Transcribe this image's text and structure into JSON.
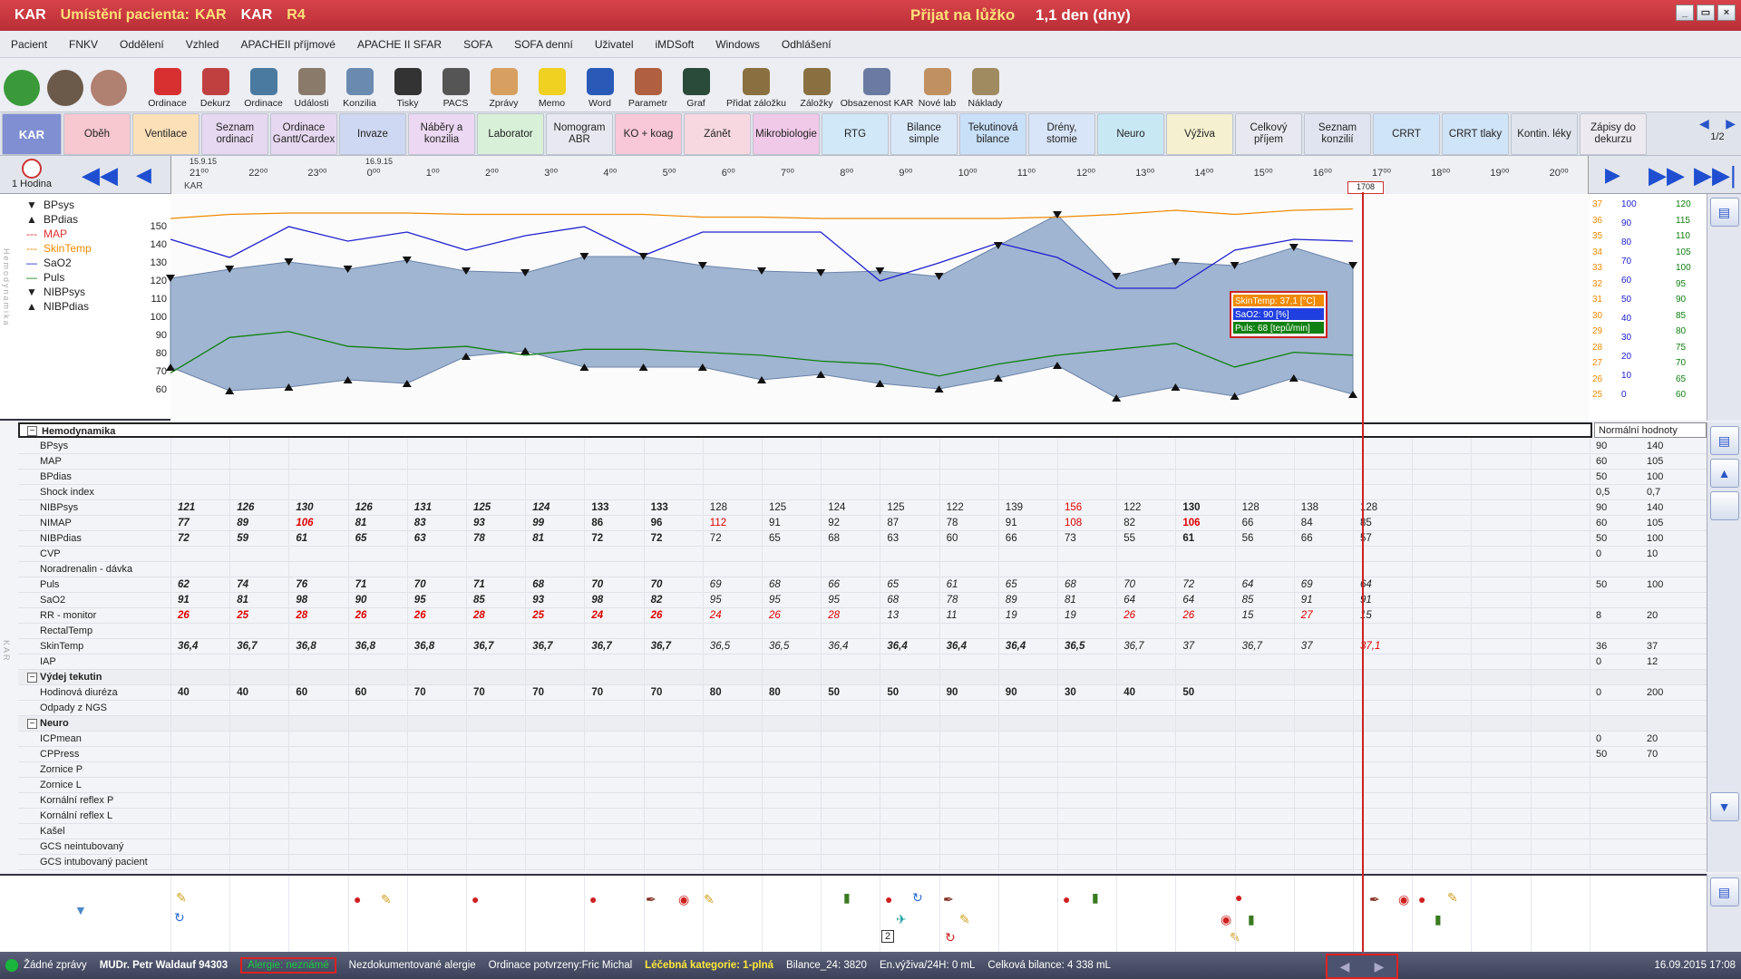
{
  "title": {
    "app": "KAR",
    "location_label": "Umístění pacienta:",
    "location": "KAR",
    "ward": "KAR",
    "room": "R4",
    "admit_label": "Přijat na lůžko",
    "admit_value": "1,1 den (dny)"
  },
  "window_buttons": [
    "_",
    "▭",
    "×"
  ],
  "menu": [
    "Pacient",
    "FNKV",
    "Oddělení",
    "Vzhled",
    "APACHEII příjmové",
    "APACHE II SFAR",
    "SOFA",
    "SOFA denní",
    "Uživatel",
    "iMDSoft",
    "Windows",
    "Odhlášení"
  ],
  "toolbar": [
    {
      "label": "",
      "icon": "refresh-icon",
      "color": "#3a9a3a",
      "big": true
    },
    {
      "label": "",
      "icon": "doctor-avatar-icon",
      "color": "#6b5a4a",
      "big": true
    },
    {
      "label": "",
      "icon": "nurse-avatar-icon",
      "color": "#b08070",
      "big": true
    },
    {
      "label": "Ordinace",
      "icon": "alarm-clock-icon",
      "color": "#d83030"
    },
    {
      "label": "Dekurz",
      "icon": "books-icon",
      "color": "#c04040"
    },
    {
      "label": "Ordinace",
      "icon": "server-icon",
      "color": "#4a7aa0"
    },
    {
      "label": "Události",
      "icon": "person-writing-icon",
      "color": "#8a7a6a"
    },
    {
      "label": "Konzilia",
      "icon": "doctor-icon",
      "color": "#6a8ab0"
    },
    {
      "label": "Tisky",
      "icon": "printer-icon",
      "color": "#333333"
    },
    {
      "label": "PACS",
      "icon": "xray-icon",
      "color": "#555555"
    },
    {
      "label": "Zprávy",
      "icon": "envelope-icon",
      "color": "#d8a060"
    },
    {
      "label": "Memo",
      "icon": "sticky-note-icon",
      "color": "#f0d020"
    },
    {
      "label": "Word",
      "icon": "word-icon",
      "color": "#2a5ab8"
    },
    {
      "label": "Parametr",
      "icon": "technician-icon",
      "color": "#b06040"
    },
    {
      "label": "Graf",
      "icon": "monitor-graph-icon",
      "color": "#2a4a3a"
    },
    {
      "label": "Přidat záložku",
      "icon": "bookmark-add-icon",
      "color": "#8a7040",
      "wide": true
    },
    {
      "label": "Záložky",
      "icon": "bookmarks-icon",
      "color": "#8a7040"
    },
    {
      "label": "Obsazenost KAR",
      "icon": "bed-occupancy-icon",
      "color": "#6a7aa0",
      "wide": true
    },
    {
      "label": "Nové lab",
      "icon": "lab-flask-icon",
      "color": "#c09060"
    },
    {
      "label": "Náklady",
      "icon": "money-bag-icon",
      "color": "#a08a60"
    }
  ],
  "tabs": [
    {
      "label": "KAR",
      "color": "#7f8fd2"
    },
    {
      "label": "Oběh",
      "color": "#f7c8d0"
    },
    {
      "label": "Ventilace",
      "color": "#fbe0b8"
    },
    {
      "label": "Seznam ordinací",
      "color": "#e6d8f0"
    },
    {
      "label": "Ordinace Gantt/Cardex",
      "color": "#e6d8f0"
    },
    {
      "label": "Invaze",
      "color": "#cfd8f2"
    },
    {
      "label": "Náběry a konzilia",
      "color": "#ecd8f2"
    },
    {
      "label": "Laborator",
      "color": "#d8f0d8"
    },
    {
      "label": "Nomogram ABR",
      "color": "#e8e8f0"
    },
    {
      "label": "KO + koag",
      "color": "#f8c8d8"
    },
    {
      "label": "Zánět",
      "color": "#f8d8e0"
    },
    {
      "label": "Mikrobiologie",
      "color": "#f0c8e8"
    },
    {
      "label": "RTG",
      "color": "#d0e8f8"
    },
    {
      "label": "Bilance simple",
      "color": "#d8e8f8"
    },
    {
      "label": "Tekutinová bilance",
      "color": "#c8e0f8"
    },
    {
      "label": "Drény, stomie",
      "color": "#d8e4f8"
    },
    {
      "label": "Neuro",
      "color": "#c8e8f4"
    },
    {
      "label": "Výživa",
      "color": "#f4f0d0"
    },
    {
      "label": "Celkový příjem",
      "color": "#e8e8f0"
    },
    {
      "label": "Seznam konzilií",
      "color": "#e0e4f0"
    },
    {
      "label": "CRRT",
      "color": "#d0e4f8"
    },
    {
      "label": "CRRT tlaky",
      "color": "#d0e4f8"
    },
    {
      "label": "Kontin. léky",
      "color": "#e0e4ec"
    },
    {
      "label": "Zápisy do dekurzu",
      "color": "#eceaf0"
    }
  ],
  "tab_page": "1/2",
  "timebar": {
    "interval": "1 Hodina",
    "date1": "15.9.15",
    "date2": "16.9.15",
    "ward": "KAR",
    "marker": "1708",
    "ticks": [
      "21⁰⁰",
      "22⁰⁰",
      "23⁰⁰",
      "0⁰⁰",
      "1⁰⁰",
      "2⁰⁰",
      "3⁰⁰",
      "4⁰⁰",
      "5⁰⁰",
      "6⁰⁰",
      "7⁰⁰",
      "8⁰⁰",
      "9⁰⁰",
      "10⁰⁰",
      "11⁰⁰",
      "12⁰⁰",
      "13⁰⁰",
      "14⁰⁰",
      "15⁰⁰",
      "16⁰⁰",
      "17⁰⁰",
      "18⁰⁰",
      "19⁰⁰",
      "20⁰⁰"
    ]
  },
  "legend": [
    {
      "label": "BPsys",
      "color": "#222222",
      "sym": "▼"
    },
    {
      "label": "BPdias",
      "color": "#222222",
      "sym": "▲"
    },
    {
      "label": "MAP",
      "color": "#e03030",
      "sym": "---"
    },
    {
      "label": "SkinTemp",
      "color": "#f08a00",
      "sym": "---"
    },
    {
      "label": "SaO2",
      "color": "#2020d0",
      "sym": "—"
    },
    {
      "label": "Puls",
      "color": "#108010",
      "sym": "—"
    },
    {
      "label": "NIBPsys",
      "color": "#222222",
      "sym": "▼"
    },
    {
      "label": "NIBPdias",
      "color": "#222222",
      "sym": "▲"
    }
  ],
  "side_label_chart": "Hemodynamika",
  "side_label_grid": "KAR",
  "yaxis": [
    "150",
    "140",
    "130",
    "120",
    "110",
    "100",
    "90",
    "80",
    "70",
    "60"
  ],
  "right_scales": {
    "temp": [
      "37",
      "36",
      "35",
      "34",
      "33",
      "32",
      "31",
      "30",
      "29",
      "28",
      "27",
      "26",
      "25"
    ],
    "sao2": [
      "100",
      "90",
      "80",
      "70",
      "60",
      "50",
      "40",
      "30",
      "20",
      "10",
      "0"
    ],
    "puls": [
      "120",
      "115",
      "110",
      "105",
      "100",
      "95",
      "90",
      "85",
      "80",
      "75",
      "70",
      "65",
      "60"
    ]
  },
  "colors": {
    "temp": "#f08a00",
    "sao2": "#2020d0",
    "puls": "#108010"
  },
  "tooltip": {
    "l1": "SkinTemp: 37,1 [°C]",
    "l2": "SaO2: 90 [%]",
    "l3": "Puls: 68 [tepů/min]"
  },
  "chart_data": {
    "type": "line",
    "x": [
      "21:00",
      "22:00",
      "23:00",
      "0:00",
      "1:00",
      "2:00",
      "3:00",
      "4:00",
      "5:00",
      "6:00",
      "7:00",
      "8:00",
      "9:00",
      "10:00",
      "11:00",
      "12:00",
      "13:00",
      "14:00",
      "15:00",
      "16:00",
      "17:00"
    ],
    "ylim": [
      55,
      155
    ],
    "series": [
      {
        "name": "NIBPsys",
        "values": [
          121,
          126,
          130,
          126,
          131,
          125,
          124,
          133,
          133,
          128,
          125,
          124,
          125,
          122,
          139,
          156,
          122,
          130,
          128,
          138,
          128
        ]
      },
      {
        "name": "NIBPdias",
        "values": [
          72,
          59,
          61,
          65,
          63,
          78,
          81,
          72,
          72,
          72,
          65,
          68,
          63,
          60,
          66,
          73,
          55,
          61,
          56,
          66,
          57
        ]
      },
      {
        "name": "SaO2",
        "values": [
          91,
          81,
          98,
          90,
          95,
          85,
          93,
          98,
          82,
          95,
          95,
          95,
          68,
          78,
          89,
          81,
          64,
          64,
          85,
          91,
          90
        ]
      },
      {
        "name": "Puls",
        "values": [
          62,
          74,
          76,
          71,
          70,
          71,
          68,
          70,
          70,
          69,
          68,
          66,
          65,
          61,
          65,
          68,
          70,
          72,
          64,
          69,
          68
        ]
      },
      {
        "name": "SkinTemp",
        "values": [
          36.4,
          36.7,
          36.8,
          36.8,
          36.8,
          36.7,
          36.7,
          36.7,
          36.7,
          36.5,
          36.5,
          36.4,
          36.4,
          36.4,
          36.4,
          36.5,
          36.7,
          37,
          36.7,
          37,
          37.1
        ]
      }
    ]
  },
  "grid": {
    "header": "Hemodynamika",
    "norm_header": "Normální hodnoty",
    "rows": [
      {
        "label": "BPsys",
        "norm": [
          "90",
          "140"
        ]
      },
      {
        "label": "MAP",
        "norm": [
          "60",
          "105"
        ]
      },
      {
        "label": "BPdias",
        "norm": [
          "50",
          "100"
        ]
      },
      {
        "label": "Shock index",
        "norm": [
          "0,5",
          "0,7"
        ]
      },
      {
        "label": "NIBPsys",
        "norm": [
          "90",
          "140"
        ],
        "values": [
          "121",
          "126",
          "130",
          "126",
          "131",
          "125",
          "124",
          "133",
          "133",
          "128",
          "125",
          "124",
          "125",
          "122",
          "139",
          "156",
          "122",
          "130",
          "128",
          "138",
          "128"
        ],
        "styles": [
          "bi",
          "bi",
          "bi",
          "bi",
          "bi",
          "bi",
          "bi",
          "b",
          "b",
          "",
          "",
          "",
          "",
          "",
          "",
          "red",
          "",
          "b",
          "",
          "",
          ""
        ]
      },
      {
        "label": "NIMAP",
        "norm": [
          "60",
          "105"
        ],
        "values": [
          "77",
          "89",
          "106",
          "81",
          "83",
          "93",
          "99",
          "86",
          "96",
          "112",
          "91",
          "92",
          "87",
          "78",
          "91",
          "108",
          "82",
          "106",
          "66",
          "84",
          "85"
        ],
        "styles": [
          "bi",
          "bi",
          "bi red",
          "bi",
          "bi",
          "bi",
          "bi",
          "b",
          "b",
          "red",
          "",
          "",
          "",
          "",
          "",
          "red",
          "",
          "b red",
          "",
          "",
          ""
        ]
      },
      {
        "label": "NIBPdias",
        "norm": [
          "50",
          "100"
        ],
        "values": [
          "72",
          "59",
          "61",
          "65",
          "63",
          "78",
          "81",
          "72",
          "72",
          "72",
          "65",
          "68",
          "63",
          "60",
          "66",
          "73",
          "55",
          "61",
          "56",
          "66",
          "57"
        ],
        "styles": [
          "bi",
          "bi",
          "bi",
          "bi",
          "bi",
          "bi",
          "bi",
          "b",
          "b",
          "",
          "",
          "",
          "",
          "",
          "",
          "",
          "",
          "b",
          "",
          "",
          ""
        ]
      },
      {
        "label": "CVP",
        "norm": [
          "0",
          "10"
        ]
      },
      {
        "label": "Noradrenalin - dávka",
        "norm": [
          "",
          ""
        ]
      },
      {
        "label": "Puls",
        "norm": [
          "50",
          "100"
        ],
        "values": [
          "62",
          "74",
          "76",
          "71",
          "70",
          "71",
          "68",
          "70",
          "70",
          "69",
          "68",
          "66",
          "65",
          "61",
          "65",
          "68",
          "70",
          "72",
          "64",
          "69",
          "64"
        ],
        "styles": [
          "bi",
          "bi",
          "bi",
          "bi",
          "bi",
          "bi",
          "bi",
          "bi",
          "bi",
          "i",
          "i",
          "i",
          "i",
          "i",
          "i",
          "i",
          "i",
          "i",
          "i",
          "i",
          "i"
        ]
      },
      {
        "label": "SaO2",
        "norm": [
          "",
          ""
        ],
        "values": [
          "91",
          "81",
          "98",
          "90",
          "95",
          "85",
          "93",
          "98",
          "82",
          "95",
          "95",
          "95",
          "68",
          "78",
          "89",
          "81",
          "64",
          "64",
          "85",
          "91",
          "91"
        ],
        "styles": [
          "bi",
          "bi",
          "bi",
          "bi",
          "bi",
          "bi",
          "bi",
          "bi",
          "bi",
          "i",
          "i",
          "i",
          "i",
          "i",
          "i",
          "i",
          "i",
          "i",
          "i",
          "i",
          "i"
        ]
      },
      {
        "label": "RR - monitor",
        "norm": [
          "8",
          "20"
        ],
        "values": [
          "26",
          "25",
          "28",
          "26",
          "26",
          "28",
          "25",
          "24",
          "26",
          "24",
          "26",
          "28",
          "13",
          "11",
          "19",
          "19",
          "26",
          "26",
          "15",
          "27",
          "15"
        ],
        "styles": [
          "bi red",
          "bi red",
          "bi red",
          "bi red",
          "bi red",
          "bi red",
          "bi red",
          "bi red",
          "bi red",
          "i red",
          "i red",
          "i red",
          "i",
          "i",
          "i",
          "i",
          "i red",
          "i red",
          "i",
          "i red",
          "i"
        ]
      },
      {
        "label": "RectalTemp",
        "norm": [
          "",
          ""
        ]
      },
      {
        "label": "SkinTemp",
        "norm": [
          "36",
          "37"
        ],
        "values": [
          "36,4",
          "36,7",
          "36,8",
          "36,8",
          "36,8",
          "36,7",
          "36,7",
          "36,7",
          "36,7",
          "36,5",
          "36,5",
          "36,4",
          "36,4",
          "36,4",
          "36,4",
          "36,5",
          "36,7",
          "37",
          "36,7",
          "37",
          "37,1"
        ],
        "styles": [
          "bi",
          "bi",
          "bi",
          "bi",
          "bi",
          "bi",
          "bi",
          "bi",
          "bi",
          "i",
          "i",
          "i",
          "bi",
          "bi",
          "bi",
          "bi",
          "i",
          "i",
          "i",
          "i",
          "i red"
        ]
      },
      {
        "label": "IAP",
        "norm": [
          "0",
          "12"
        ]
      },
      {
        "section": "Výdej tekutin"
      },
      {
        "label": "Hodinová diuréza",
        "norm": [
          "0",
          "200"
        ],
        "values": [
          "40",
          "40",
          "60",
          "60",
          "70",
          "70",
          "70",
          "70",
          "70",
          "80",
          "80",
          "50",
          "50",
          "90",
          "90",
          "30",
          "40",
          "50"
        ],
        "styles": [
          "b",
          "b",
          "b",
          "b",
          "b",
          "b",
          "b",
          "b",
          "b",
          "b",
          "b",
          "b",
          "b",
          "b",
          "b",
          "b",
          "b",
          "b"
        ]
      },
      {
        "label": "Odpady z NGS",
        "norm": [
          "",
          ""
        ]
      },
      {
        "section": "Neuro"
      },
      {
        "label": "ICPmean",
        "norm": [
          "0",
          "20"
        ]
      },
      {
        "label": "CPPress",
        "norm": [
          "50",
          "70"
        ]
      },
      {
        "label": "Zornice P",
        "norm": [
          "",
          ""
        ]
      },
      {
        "label": "Zornice L",
        "norm": [
          "",
          ""
        ]
      },
      {
        "label": "Kornální reflex P",
        "norm": [
          "",
          ""
        ]
      },
      {
        "label": "Kornální reflex L",
        "norm": [
          "",
          ""
        ]
      },
      {
        "label": "Kašel",
        "norm": [
          "",
          ""
        ]
      },
      {
        "label": "GCS neintubovaný",
        "norm": [
          "",
          ""
        ]
      },
      {
        "label": "GCS intubovaný pacient",
        "norm": [
          "",
          ""
        ]
      }
    ]
  },
  "events": {
    "badge": "2"
  },
  "status": {
    "messages": "Žádné zprávy",
    "doctor": "MUDr. Petr Waldauf  94303",
    "allergy": "Alergie: neznámé",
    "allergy_note": "Nezdokumentované alergie",
    "ordinace": "Ordinace potvrzeny:Fric Michal",
    "category": "Léčebná kategorie: 1-plná",
    "balance24": "Bilance_24: 3820",
    "nutrition": "En.výživa/24H: 0 mL",
    "total_balance": "Celková bilance: 4 338 mL",
    "datetime": "16.09.2015 17:08"
  }
}
